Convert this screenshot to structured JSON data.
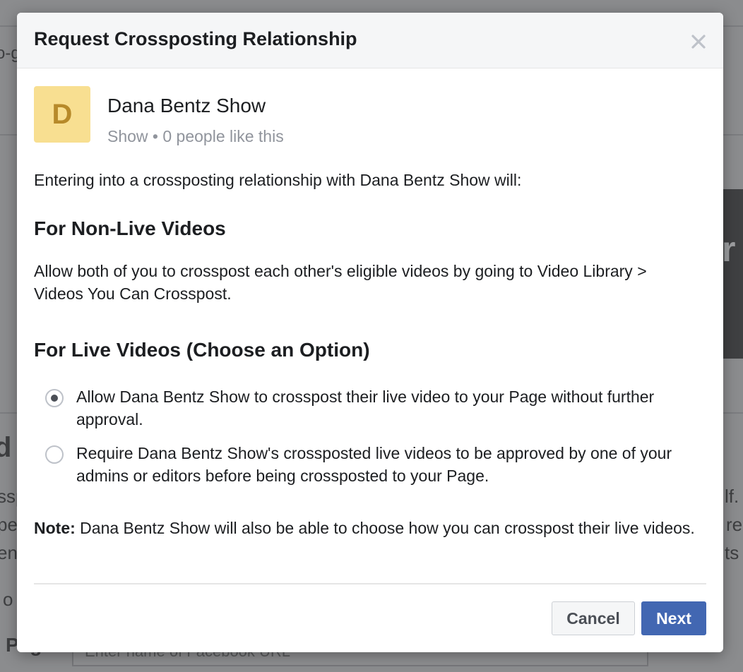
{
  "background": {
    "fragments": [
      "o-g",
      "d",
      "ssp",
      "pe",
      "en",
      "o",
      "r",
      "lf.",
      "re",
      "ts"
    ],
    "page_label": "Page",
    "page_field_placeholder": "Enter name of Facebook URL"
  },
  "dialog": {
    "title": "Request Crossposting Relationship",
    "close_label": "×",
    "page": {
      "avatar_letter": "D",
      "avatar_color": "#f8df91",
      "name": "Dana Bentz Show",
      "meta": "Show • 0 people like this"
    },
    "intro": "Entering into a crossposting relationship with Dana Bentz Show will:",
    "non_live": {
      "heading": "For Non-Live Videos",
      "text": "Allow both of you to crosspost each other's eligible videos by going to Video Library > Videos You Can Crosspost."
    },
    "live": {
      "heading": "For Live Videos (Choose an Option)",
      "options": [
        {
          "label": "Allow Dana Bentz Show to crosspost their live video to your Page without further approval.",
          "selected": true
        },
        {
          "label": "Require Dana Bentz Show's crossposted live videos to be approved by one of your admins or editors before being crossposted to your Page.",
          "selected": false
        }
      ]
    },
    "note": {
      "label": "Note:",
      "text": " Dana Bentz Show will also be able to choose how you can crosspost their live videos."
    },
    "buttons": {
      "cancel": "Cancel",
      "next": "Next"
    },
    "colors": {
      "primary": "#4267b2",
      "header_bg": "#f5f6f7"
    }
  }
}
